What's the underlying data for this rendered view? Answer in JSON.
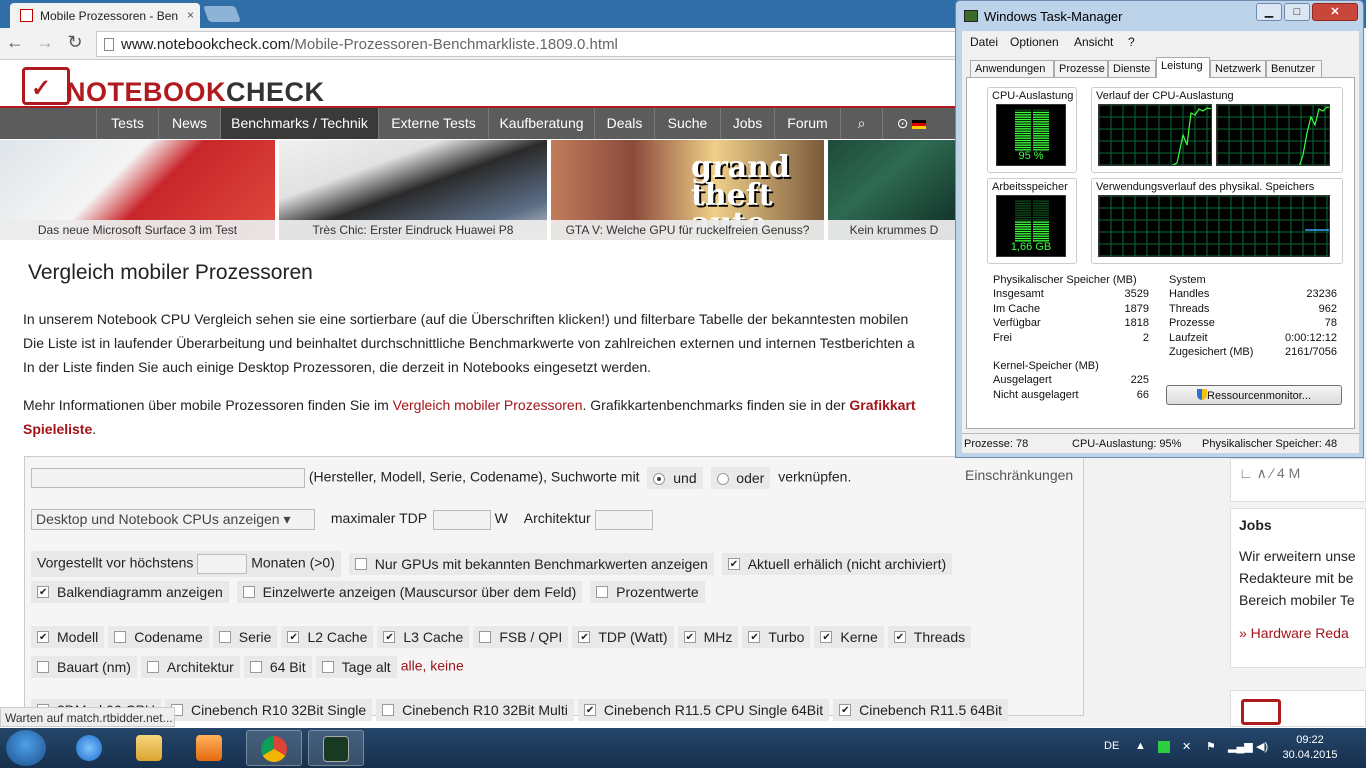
{
  "browser": {
    "tab_title": "Mobile Prozessoren - Ben",
    "tab_close": "×",
    "url_host": "www.notebookcheck.com",
    "url_path": "/Mobile-Prozessoren-Benchmarkliste.1809.0.html",
    "status_text": "Warten auf match.rtbidder.net..."
  },
  "site": {
    "logo_notebook": "NOTEBOOK",
    "logo_check": "CHECK",
    "nav": [
      "Tests",
      "News",
      "Benchmarks / Technik",
      "Externe Tests",
      "Kaufberatung",
      "Deals",
      "Suche",
      "Jobs",
      "Forum"
    ],
    "promos": [
      "Das neue Microsoft Surface 3 im Test",
      "Très Chic: Erster Eindruck Huawei P8",
      "GTA V: Welche GPU für ruckelfreien Genuss?",
      "Kein krummes D"
    ],
    "page_title": "Vergleich mobiler Prozessoren",
    "intro_line1": "In unserem Notebook CPU Vergleich sehen sie eine sortierbare (auf die Überschriften klicken!) und filterbare Tabelle der bekanntesten mobilen",
    "intro_line2": "Die Liste ist in laufender Überarbeitung und beinhaltet durchschnittliche Benchmarkwerte von zahlreichen externen und internen Testberichten a",
    "intro_line3": "In der Liste finden Sie auch einige Desktop Prozessoren, die derzeit in Notebooks eingesetzt werden.",
    "more_prefix": "Mehr Informationen über mobile Prozessoren finden Sie im ",
    "more_link": "Vergleich mobiler Prozessoren",
    "more_mid": ". Grafikkartenbenchmarks finden sie in der ",
    "more_bold": "Grafikkart",
    "more_line2": "Spieleliste",
    "more_end": "."
  },
  "filters": {
    "search_hint": "(Hersteller, Modell, Serie, Codename), Suchworte mit",
    "and_label": "und",
    "or_label": "oder",
    "combine_label": "verknüpfen.",
    "restrictions": "Einschränkungen",
    "cpu_select": "Desktop und Notebook CPUs anzeigen",
    "tdp_label": "maximaler TDP",
    "tdp_unit": "W",
    "arch_label": "Architektur",
    "presented_label": "Vorgestellt vor höchstens",
    "months_label": "Monaten (>0)",
    "only_gpus": "Nur GPUs mit bekannten Benchmarkwerten anzeigen",
    "current": "Aktuell erhälich (nicht archiviert)",
    "bar_chart": "Balkendiagramm anzeigen",
    "single_values": "Einzelwerte anzeigen (Mauscursor über dem Feld)",
    "percent": "Prozentwerte",
    "columns1": [
      {
        "label": "Modell",
        "checked": true
      },
      {
        "label": "Codename",
        "checked": false
      },
      {
        "label": "Serie",
        "checked": false
      },
      {
        "label": "L2 Cache",
        "checked": true
      },
      {
        "label": "L3 Cache",
        "checked": true
      },
      {
        "label": "FSB / QPI",
        "checked": false
      },
      {
        "label": "TDP (Watt)",
        "checked": true
      },
      {
        "label": "MHz",
        "checked": true
      },
      {
        "label": "Turbo",
        "checked": true
      },
      {
        "label": "Kerne",
        "checked": true
      },
      {
        "label": "Threads",
        "checked": true
      }
    ],
    "columns2": [
      {
        "label": "Bauart (nm)",
        "checked": false
      },
      {
        "label": "Architektur",
        "checked": false
      },
      {
        "label": "64 Bit",
        "checked": false
      },
      {
        "label": "Tage alt",
        "checked": false
      }
    ],
    "all_none": "alle, keine",
    "partial_row": [
      "3DMark06 CPU",
      "Cinebench R10 32Bit Single",
      "Cinebench R10 32Bit Multi",
      "Cinebench R11.5 CPU Single 64Bit",
      "Cinebench R11.5 64Bit"
    ]
  },
  "sidebar": {
    "teaser_text": "4 M",
    "jobs_title": "Jobs",
    "jobs_line1": "Wir erweitern unse",
    "jobs_line2": "Redakteure mit be",
    "jobs_line3": "Bereich mobiler Te",
    "jobs_link": "» Hardware Reda"
  },
  "taskmanager": {
    "title": "Windows Task-Manager",
    "menu": [
      "Datei",
      "Optionen",
      "Ansicht",
      "?"
    ],
    "tabs": [
      "Anwendungen",
      "Prozesse",
      "Dienste",
      "Leistung",
      "Netzwerk",
      "Benutzer"
    ],
    "active_tab": "Leistung",
    "cpu_label": "CPU-Auslastung",
    "cpu_value": "95 %",
    "cpu_percent": 95,
    "cpu_history_label": "Verlauf der CPU-Auslastung",
    "mem_label": "Arbeitsspeicher",
    "mem_value": "1,66 GB",
    "mem_history_label": "Verwendungsverlauf des physikal. Speichers",
    "phys_title": "Physikalischer Speicher (MB)",
    "phys": [
      {
        "k": "Insgesamt",
        "v": "3529"
      },
      {
        "k": "Im Cache",
        "v": "1879"
      },
      {
        "k": "Verfügbar",
        "v": "1818"
      },
      {
        "k": "Frei",
        "v": "2"
      }
    ],
    "sys_title": "System",
    "sys": [
      {
        "k": "Handles",
        "v": "23236"
      },
      {
        "k": "Threads",
        "v": "962"
      },
      {
        "k": "Prozesse",
        "v": "78"
      },
      {
        "k": "Laufzeit",
        "v": "0:00:12:12"
      },
      {
        "k": "Zugesichert (MB)",
        "v": "2161/7056"
      }
    ],
    "kernel_title": "Kernel-Speicher (MB)",
    "kernel": [
      {
        "k": "Ausgelagert",
        "v": "225"
      },
      {
        "k": "Nicht ausgelagert",
        "v": "66"
      }
    ],
    "resmon_button": "Ressourcenmonitor...",
    "status": [
      "Prozesse: 78",
      "CPU-Auslastung: 95%",
      "Physikalischer Speicher: 48"
    ]
  },
  "taskbar": {
    "lang": "DE",
    "time": "09:22",
    "date": "30.04.2015"
  },
  "colors": {
    "brand_red": "#b0191e",
    "nav_gray": "#5c5c5c",
    "meter_green": "#3cff3c",
    "graph_grid": "#0a6b36"
  }
}
